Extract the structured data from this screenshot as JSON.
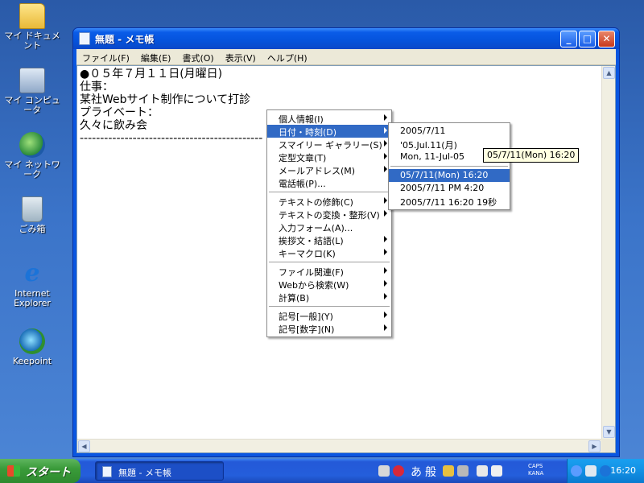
{
  "desktop": {
    "icons": [
      {
        "label": "マイ ドキュメント",
        "icon": "folder-icon"
      },
      {
        "label": "マイ コンピュータ",
        "icon": "computer-icon"
      },
      {
        "label": "マイ ネットワーク",
        "icon": "network-icon"
      },
      {
        "label": "ごみ箱",
        "icon": "recycle-bin-icon"
      },
      {
        "label": "Internet Explorer",
        "icon": "internet-explorer-icon"
      },
      {
        "label": "Keepoint",
        "icon": "keepoint-icon"
      }
    ]
  },
  "window": {
    "title": "無題 - メモ帳",
    "minimize": "_",
    "maximize": "□",
    "close": "✕",
    "menu": [
      "ファイル(F)",
      "編集(E)",
      "書式(O)",
      "表示(V)",
      "ヘルプ(H)"
    ],
    "lines": [
      "●０５年７月１１日(月曜日)",
      "",
      "仕事：",
      "某社Webサイト制作について打診",
      "",
      "プライベート：",
      "久々に飲み会",
      "---------------------------------------------"
    ]
  },
  "context_menu": {
    "groups": [
      [
        "個人情報(I)",
        "日付・時刻(D)",
        "スマイリー ギャラリー(S)",
        "定型文章(T)",
        "メールアドレス(M)",
        "電話帳(P)..."
      ],
      [
        "テキストの修飾(C)",
        "テキストの変換・整形(V)",
        "入力フォーム(A)...",
        "挨拶文・結語(L)",
        "キーマクロ(K)"
      ],
      [
        "ファイル関連(F)",
        "Webから検索(W)",
        "計算(B)"
      ],
      [
        "記号[一般](Y)",
        "記号[数字](N)"
      ]
    ],
    "selected": "日付・時刻(D)"
  },
  "submenu": {
    "groups": [
      [
        "2005/7/11",
        "'05.Jul.11(月)",
        "Mon, 11-Jul-05"
      ],
      [
        "05/7/11(Mon) 16:20",
        "2005/7/11 PM 4:20",
        "2005/7/11 16:20 19秒"
      ]
    ],
    "selected": "05/7/11(Mon) 16:20"
  },
  "tooltip": "05/7/11(Mon) 16:20",
  "taskbar": {
    "start_label": "スタート",
    "task_label": "無題 - メモ帳",
    "ime_kana": "あ",
    "ime_mode": "般",
    "caps": "CAPS",
    "kana": "KANA",
    "clock": "16:20"
  }
}
